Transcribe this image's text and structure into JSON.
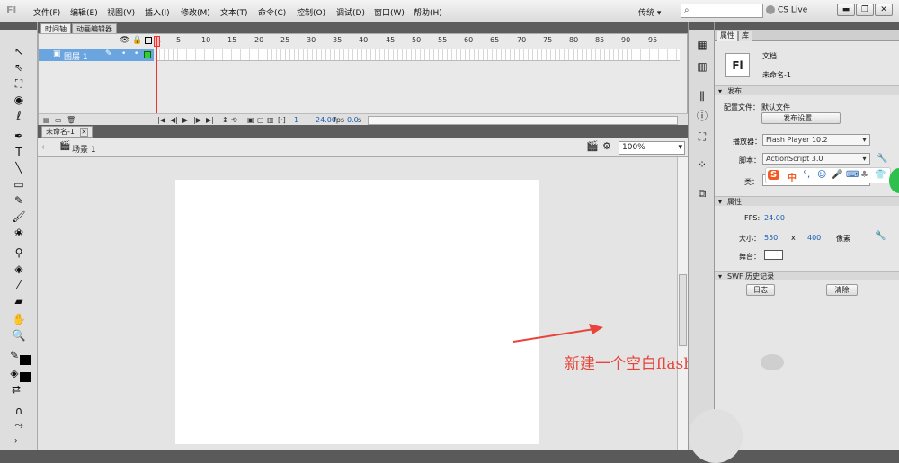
{
  "app": {
    "logo": "Fl"
  },
  "menu": [
    "文件(F)",
    "编辑(E)",
    "视图(V)",
    "插入(I)",
    "修改(M)",
    "文本(T)",
    "命令(C)",
    "控制(O)",
    "调试(D)",
    "窗口(W)",
    "帮助(H)"
  ],
  "topbar": {
    "workspace": "传统 ▾",
    "cslive": "CS Live",
    "window_min": "▬",
    "window_restore": "❐",
    "window_close": "✕"
  },
  "timeline": {
    "tabs": [
      "时间轴",
      "动画编辑器"
    ],
    "ruler": [
      "1",
      "5",
      "10",
      "15",
      "20",
      "25",
      "30",
      "35",
      "40",
      "45",
      "50",
      "55",
      "60",
      "65",
      "70",
      "75",
      "80",
      "85",
      "90",
      "95"
    ],
    "layer_name": "图层 1",
    "fps": "24.00",
    "fps_unit": "fps",
    "time": "0.0",
    "time_unit": "s",
    "frame": "1"
  },
  "document": {
    "tab": "未命名-1",
    "scene": "场景 1",
    "zoom": "100%"
  },
  "annotation": "新建一个空白flash文档",
  "properties": {
    "tabs": [
      "属性",
      "库"
    ],
    "doc_type": "文档",
    "doc_name": "未命名-1",
    "doc_icon": "Fl",
    "publish_section": "发布",
    "profile_label": "配置文件：",
    "profile_value": "默认文件",
    "publish_settings_button": "发布设置...",
    "player_label": "播放器：",
    "player_value": "Flash Player 10.2",
    "script_label": "脚本：",
    "script_value": "ActionScript 3.0",
    "class_label": "类：",
    "props_section": "属性",
    "fps_label": "FPS:",
    "fps_value": "24.00",
    "size_label": "大小：",
    "width": "550",
    "x": "x",
    "height": "400",
    "unit": "像素",
    "stage_label": "舞台：",
    "swf_section": "SWF 历史记录",
    "log_button": "日志",
    "clear_button": "清除"
  },
  "ime": {
    "logo": "S",
    "mode": "中"
  },
  "colors": {
    "accent": "#6aa5e0",
    "annotation": "#e8443a",
    "stage": "#ffffff"
  }
}
